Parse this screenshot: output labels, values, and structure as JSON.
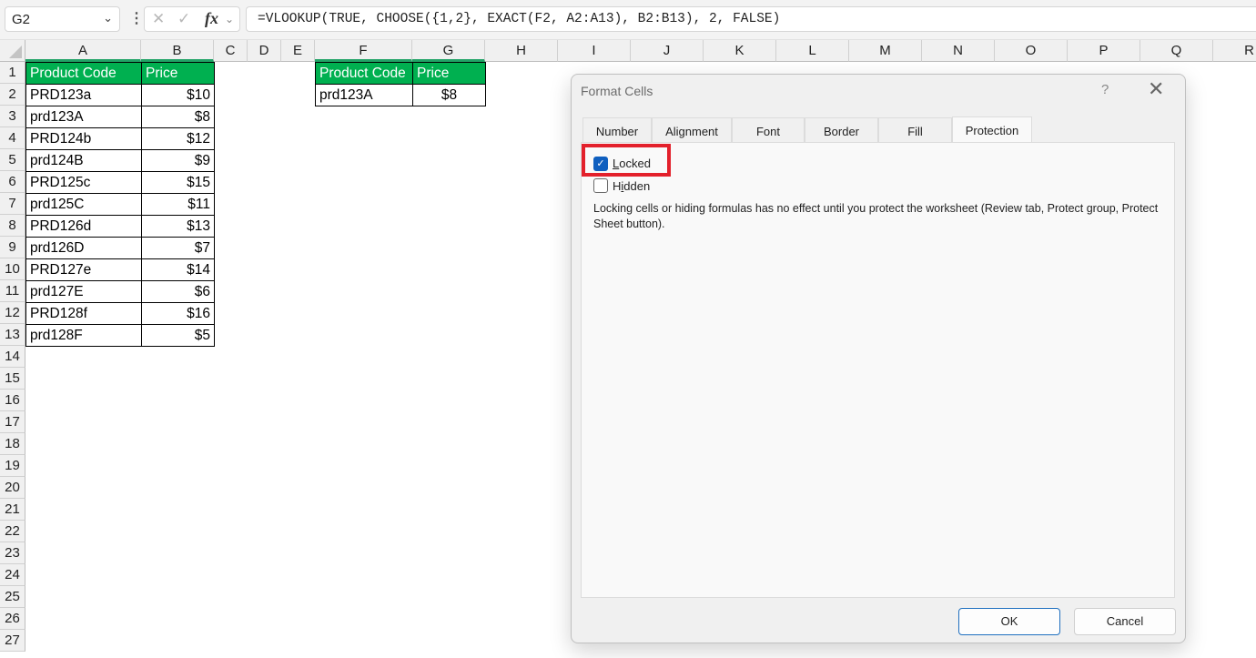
{
  "formula_bar": {
    "name_box": "G2",
    "formula": "=VLOOKUP(TRUE, CHOOSE({1,2}, EXACT(F2, A2:A13), B2:B13), 2, FALSE)",
    "icons": {
      "name_box_dropdown": "chevron-down-icon",
      "more": "vertical-dots-icon",
      "cancel": "x-icon",
      "enter": "check-icon",
      "insert_function": "fx-icon",
      "expand": "chevron-down-icon"
    },
    "fx_label": "fx"
  },
  "grid": {
    "columns": [
      "A",
      "B",
      "C",
      "D",
      "E",
      "F",
      "G",
      "H",
      "I",
      "J",
      "K",
      "L",
      "M",
      "N",
      "O",
      "P",
      "Q",
      "R"
    ],
    "rows": [
      "1",
      "2",
      "3",
      "4",
      "5",
      "6",
      "7",
      "8",
      "9",
      "10",
      "11",
      "12",
      "13",
      "14",
      "15",
      "16",
      "17",
      "18",
      "19",
      "20",
      "21",
      "22",
      "23",
      "24",
      "25",
      "26",
      "27"
    ],
    "colors": {
      "header_fill": "#00b050",
      "header_text": "#ffffff",
      "selected_col_indicator": "#21a366"
    }
  },
  "table_main": {
    "headers": [
      "Product Code",
      "Price"
    ],
    "rows": [
      [
        "PRD123a",
        "$10"
      ],
      [
        "prd123A",
        "$8"
      ],
      [
        "PRD124b",
        "$12"
      ],
      [
        "prd124B",
        "$9"
      ],
      [
        "PRD125c",
        "$15"
      ],
      [
        "prd125C",
        "$11"
      ],
      [
        "PRD126d",
        "$13"
      ],
      [
        "prd126D",
        "$7"
      ],
      [
        "PRD127e",
        "$14"
      ],
      [
        "prd127E",
        "$6"
      ],
      [
        "PRD128f",
        "$16"
      ],
      [
        "prd128F",
        "$5"
      ]
    ]
  },
  "table_lookup": {
    "headers": [
      "Product Code",
      "Price"
    ],
    "rows": [
      [
        "prd123A",
        "$8"
      ]
    ]
  },
  "dialog": {
    "title": "Format Cells",
    "help_label": "?",
    "close_icon": "close-icon",
    "tabs": [
      "Number",
      "Alignment",
      "Font",
      "Border",
      "Fill",
      "Protection"
    ],
    "active_tab": "Protection",
    "locked": {
      "label_prefix": "L",
      "label_rest": "ocked",
      "checked": true
    },
    "hidden": {
      "label_prefix": "H",
      "label_mid": "i",
      "label_rest": "dden",
      "checked": false
    },
    "note": "Locking cells or hiding formulas has no effect until you protect the worksheet (Review tab, Protect group, Protect Sheet button).",
    "ok_label": "OK",
    "cancel_label": "Cancel",
    "highlight_color": "#e3202b"
  }
}
